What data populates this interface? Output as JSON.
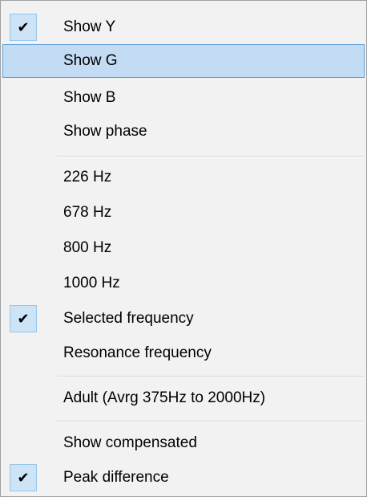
{
  "menu": {
    "items": [
      {
        "label": "Show Y",
        "checked": true,
        "highlighted": false
      },
      {
        "label": "Show G",
        "checked": false,
        "highlighted": true
      },
      {
        "label": "Show B",
        "checked": false,
        "highlighted": false
      },
      {
        "label": "Show phase",
        "checked": false,
        "highlighted": false
      },
      {
        "label": "226 Hz",
        "checked": false,
        "highlighted": false
      },
      {
        "label": "678 Hz",
        "checked": false,
        "highlighted": false
      },
      {
        "label": "800 Hz",
        "checked": false,
        "highlighted": false
      },
      {
        "label": "1000 Hz",
        "checked": false,
        "highlighted": false
      },
      {
        "label": "Selected frequency",
        "checked": true,
        "highlighted": false
      },
      {
        "label": "Resonance frequency",
        "checked": false,
        "highlighted": false
      },
      {
        "label": "Adult (Avrg 375Hz to 2000Hz)",
        "checked": false,
        "highlighted": false
      },
      {
        "label": "Show compensated",
        "checked": false,
        "highlighted": false
      },
      {
        "label": "Peak difference",
        "checked": true,
        "highlighted": false
      }
    ],
    "check_glyph": "✔",
    "colors": {
      "background": "#f2f2f2",
      "highlight": "#c3dcf3",
      "highlight_border": "#5f9fd8",
      "check_background": "#cde4f7"
    }
  }
}
